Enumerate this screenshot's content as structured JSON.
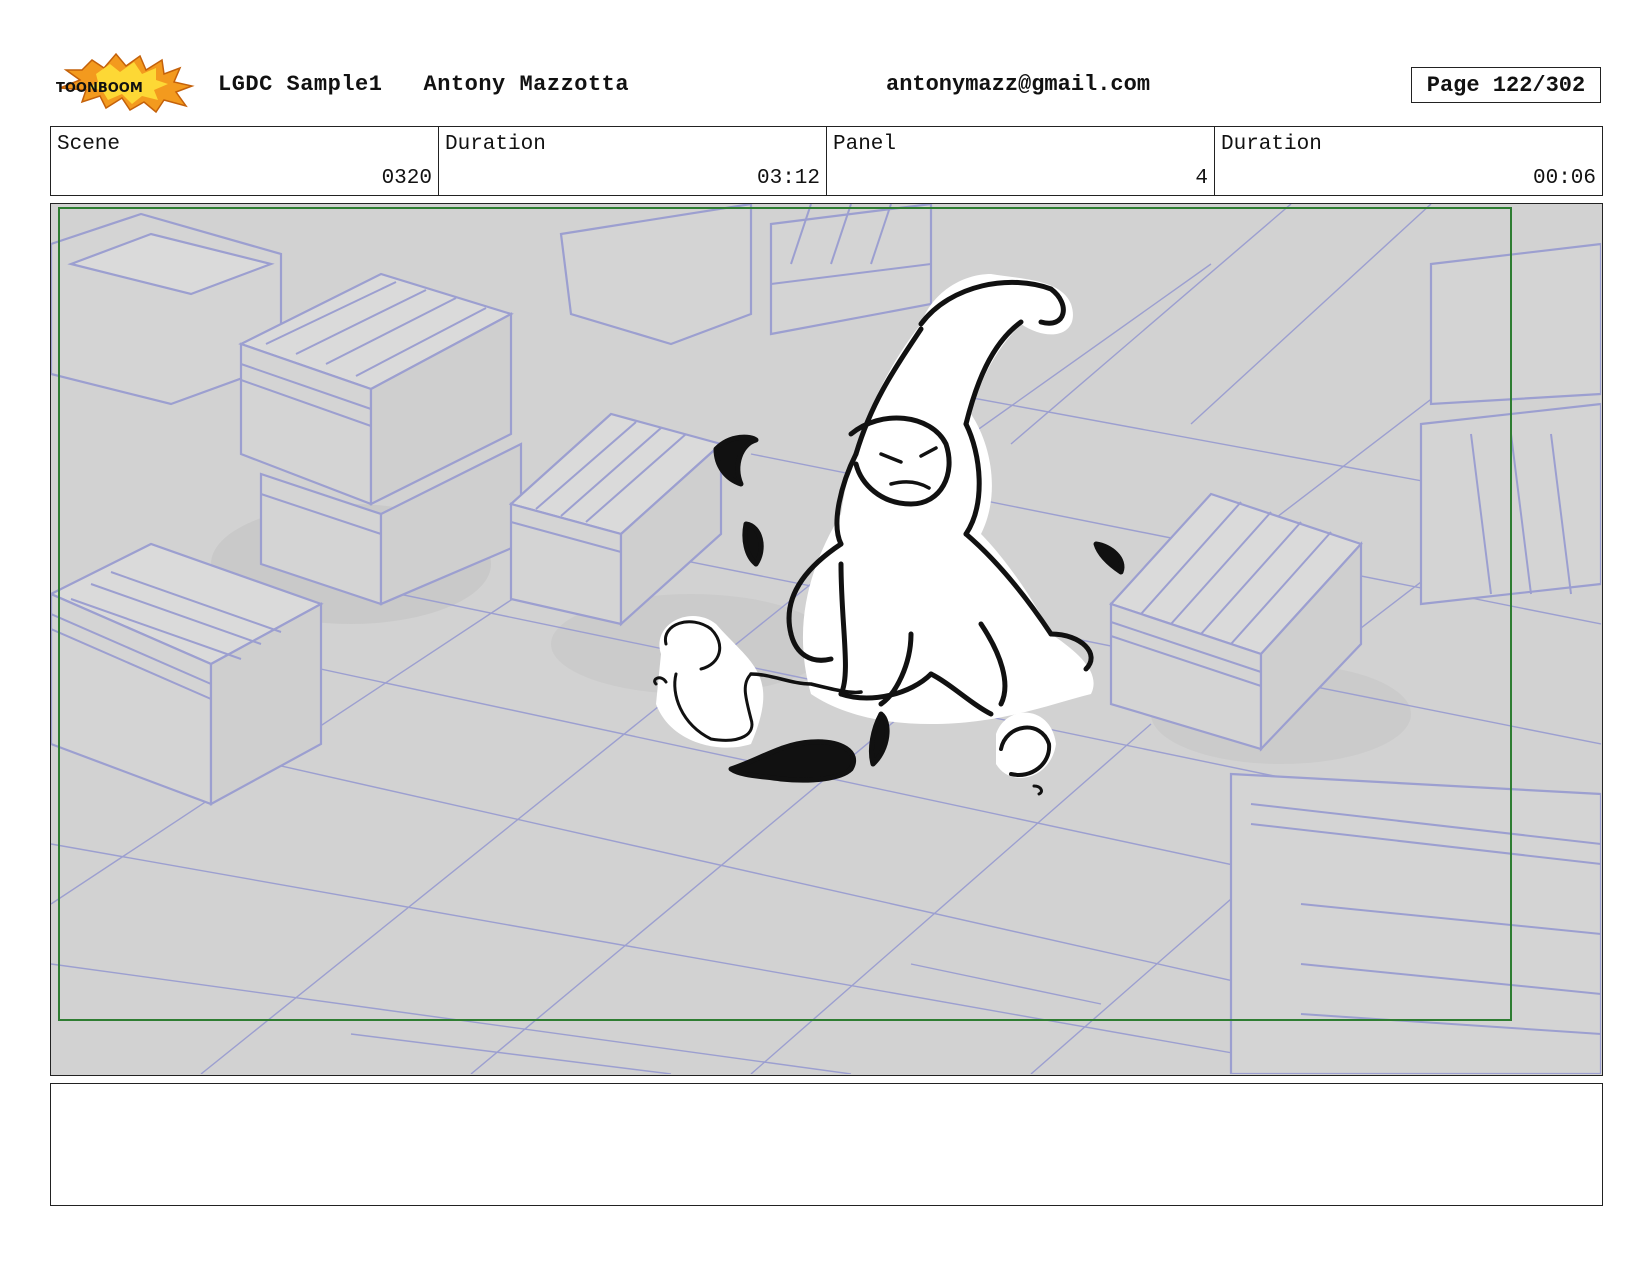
{
  "header": {
    "logo_text": "TOONBOOM",
    "project": "LGDC Sample1",
    "author": "Antony Mazzotta",
    "email": "antonymazz@gmail.com",
    "page": "Page 122/302"
  },
  "info": {
    "scene_label": "Scene",
    "scene_value": "0320",
    "scene_duration_label": "Duration",
    "scene_duration_value": "03:12",
    "panel_label": "Panel",
    "panel_value": "4",
    "panel_duration_label": "Duration",
    "panel_duration_value": "00:06"
  },
  "notes": {
    "text": ""
  },
  "colors": {
    "safe_frame": "#2e7d32",
    "background_lines": "#9c9fd0",
    "background_fill": "#d2d2d2",
    "sketch_ink": "#111111",
    "logo_orange": "#f39a1e"
  }
}
